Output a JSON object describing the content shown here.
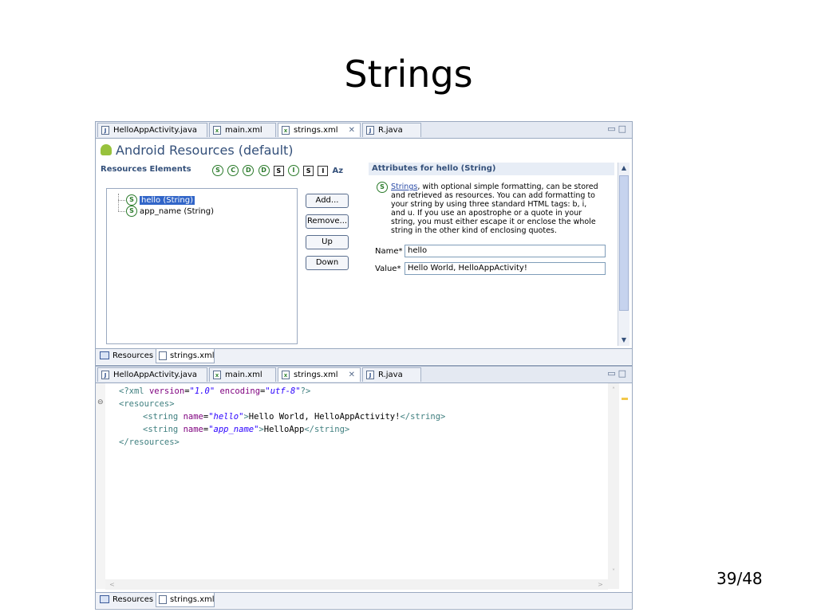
{
  "slide": {
    "title": "Strings",
    "page": "39/48"
  },
  "editor_tabs": [
    {
      "label": "HelloAppActivity.java",
      "icon": "J"
    },
    {
      "label": "main.xml",
      "icon": "x"
    },
    {
      "label": "strings.xml",
      "icon": "x",
      "active": true
    },
    {
      "label": "R.java",
      "icon": "J"
    }
  ],
  "resources_editor": {
    "header": "Android Resources (default)",
    "elements_label": "Resources Elements",
    "toolbar_icons": [
      "S",
      "C",
      "D",
      "D",
      "S",
      "I",
      "S",
      "I",
      "Az"
    ],
    "tree": [
      {
        "label": "hello (String)",
        "icon": "S",
        "selected": true
      },
      {
        "label": "app_name (String)",
        "icon": "S",
        "selected": false
      }
    ],
    "buttons": {
      "add": "Add...",
      "remove": "Remove...",
      "up": "Up",
      "down": "Down"
    },
    "attributes_title": "Attributes for hello (String)",
    "description_link": "Strings",
    "description_text": ", with optional simple formatting, can be stored and retrieved as resources. You can add formatting to your string by using three standard HTML tags: b, i, and u. If you use an apostrophe or a quote in your string, you must either escape it or enclose the whole string in the other kind of enclosing quotes.",
    "name_label": "Name*",
    "name_value": "hello",
    "value_label": "Value*",
    "value_value": "Hello World, HelloAppActivity!"
  },
  "bottom_tabs": {
    "resources": "Resources",
    "strings_xml": "strings.xml"
  },
  "xml_code": {
    "line1": {
      "open": "<?xml ",
      "a1": "version",
      "eq1": "=",
      "v1": "\"1.0\"",
      "sp": " ",
      "a2": "encoding",
      "eq2": "=",
      "v2": "\"utf-8\"",
      "close": "?>"
    },
    "line2": {
      "tag": "<resources>"
    },
    "line3": {
      "open": "<string ",
      "attr": "name",
      "eq": "=",
      "val": "\"hello\"",
      "gt": ">",
      "text": "Hello World, HelloAppActivity!",
      "close": "</string>"
    },
    "line4": {
      "open": "<string ",
      "attr": "name",
      "eq": "=",
      "val": "\"app_name\"",
      "gt": ">",
      "text": "HelloApp",
      "close": "</string>"
    },
    "line5": {
      "tag": "</resources>"
    }
  },
  "colors": {
    "tag": "#3f7f7f",
    "attribute": "#7f007f",
    "value": "#2a00ff",
    "selection": "#3165c8",
    "header": "#34507a"
  }
}
